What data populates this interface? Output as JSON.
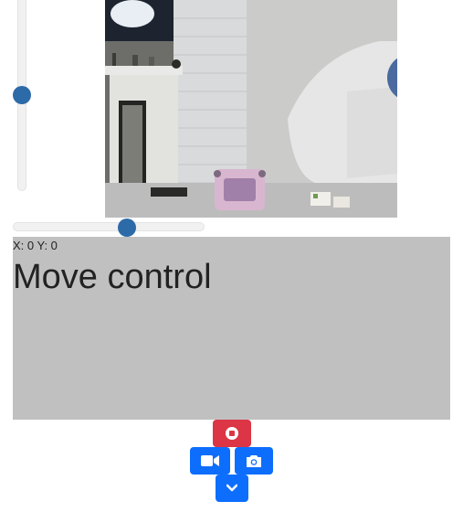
{
  "sliders": {
    "vertical": {
      "level": 0.5
    },
    "horizontal": {
      "level": 0.6
    }
  },
  "camera": {
    "alt": "camera-feed"
  },
  "move_control": {
    "coords_label": "X: 0 Y: 0",
    "title": "Move control"
  },
  "buttons": {
    "record": {
      "icon": "stop-circle-icon",
      "color": "#dc3545"
    },
    "video": {
      "icon": "video-camera-icon",
      "color": "#0d6efd"
    },
    "photo": {
      "icon": "camera-icon",
      "color": "#0d6efd"
    },
    "toggle": {
      "icon": "chevron-down-icon",
      "color": "#0d6efd"
    }
  }
}
